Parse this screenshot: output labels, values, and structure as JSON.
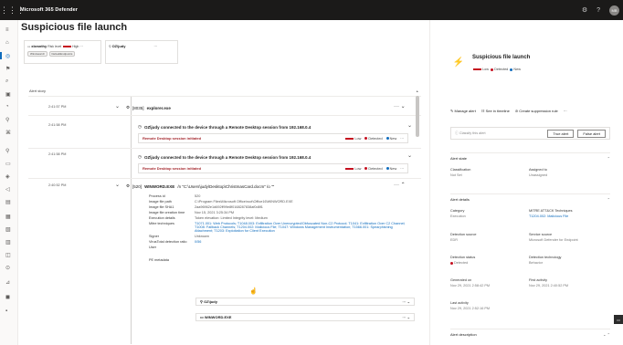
{
  "app": {
    "title": "Microsoft 365 Defender",
    "avatar_initials": "MB"
  },
  "page": {
    "title": "Suspicious file launch",
    "alert_story_label": "Alert story"
  },
  "entities": {
    "device": {
      "name": "xbranthy",
      "risk": "Risk level",
      "risk_value": "High",
      "tags": [
        "Windows10",
        "DefaultEndpoints"
      ]
    },
    "user": {
      "name": "OZ\\judy"
    }
  },
  "story": {
    "times": [
      "2:41:57 PM",
      "2:41:58 PM",
      "2:41:58 PM",
      "2:40:52 PM"
    ],
    "process1": {
      "id": "[8035]",
      "name": "explorer.exe"
    },
    "connection_text": "OZ\\judy connected to the device through a Remote Desktop session from 192.168.0.4",
    "rdp_alert": {
      "name": "Remote Desktop session initiated",
      "severity": "Low",
      "status": "Detected",
      "state": "New"
    },
    "process2": {
      "id": "[520]",
      "name": "WINWORD.EXE",
      "cmd": "/n \"C:\\Users\\judy\\Desktop\\ChristmasCard.docm\" /o \"\""
    },
    "details": [
      {
        "k": "Process id",
        "v": "520"
      },
      {
        "k": "Image file path",
        "v": "C:\\Program Files\\Microsoft Office\\root\\Office16\\WINWORD.EXE"
      },
      {
        "k": "Image file SHA1",
        "v": "2aa96962e1d692ff99e8f0168287838af0d8f1"
      },
      {
        "k": "Image file creation time",
        "v": "Nov 15, 2021 3:25:34 PM"
      },
      {
        "k": "Execution details",
        "v": "Token elevation: Limited  Integrity level: Medium"
      },
      {
        "k": "Mitre techniques",
        "v": "T1071.001: Web Protocols; T1048.003: Exfiltration Over Unencrypted/Obfuscated Non-C2 Protocol; T1041: Exfiltration Over C2 Channel; T1008: Fallback Channels; T1204.002: Malicious File; T1047: Windows Management Instrumentation; T1566.001: Spearphishing Attachment; T1203: Exploitation for Client Execution",
        "link": true
      },
      {
        "k": "Signer",
        "v": "Unknown"
      },
      {
        "k": "VirusTotal detection ratio",
        "v": "0/56",
        "link": true
      },
      {
        "k": "User",
        "v": ""
      },
      {
        "k": "PE metadata",
        "v": ""
      }
    ],
    "user_box": "OZ\\judy",
    "pe_box": "WINWORD.EXE"
  },
  "panel": {
    "title": "Suspicious file launch",
    "severity": "Low",
    "status": "Detected",
    "state": "New",
    "actions": [
      "Manage alert",
      "See in timeline",
      "Create suppression rule",
      "···"
    ],
    "classify_placeholder": "Classify this alert",
    "true_alert": "True alert",
    "false_alert": "False alert",
    "alert_state": {
      "heading": "Alert state",
      "classification_label": "Classification",
      "classification": "Not Set",
      "assigned_label": "Assigned to",
      "assigned": "Unassigned"
    },
    "alert_details": {
      "heading": "Alert details",
      "category_label": "Category",
      "category": "Execution",
      "mitre_label": "MITRE ATT&CK Techniques",
      "mitre": "T1204.002: Malicious File",
      "source_label": "Detection source",
      "source": "EDR",
      "service_label": "Service source",
      "service": "Microsoft Defender for Endpoint",
      "status_label": "Detection status",
      "status": "Detected",
      "tech_label": "Detection technology",
      "tech": "Behavior",
      "generated_label": "Generated on",
      "generated": "Nov 29, 2021 2:58:42 PM",
      "first_label": "First activity",
      "first": "Nov 29, 2021 2:40:52 PM",
      "last_label": "Last activity",
      "last": "Nov 29, 2021 2:52:16 PM"
    },
    "description_heading": "Alert description"
  },
  "colors": {
    "accent": "#0f6cbd",
    "alert_red": "#a4262c",
    "severity_low": "#c50f1f"
  }
}
